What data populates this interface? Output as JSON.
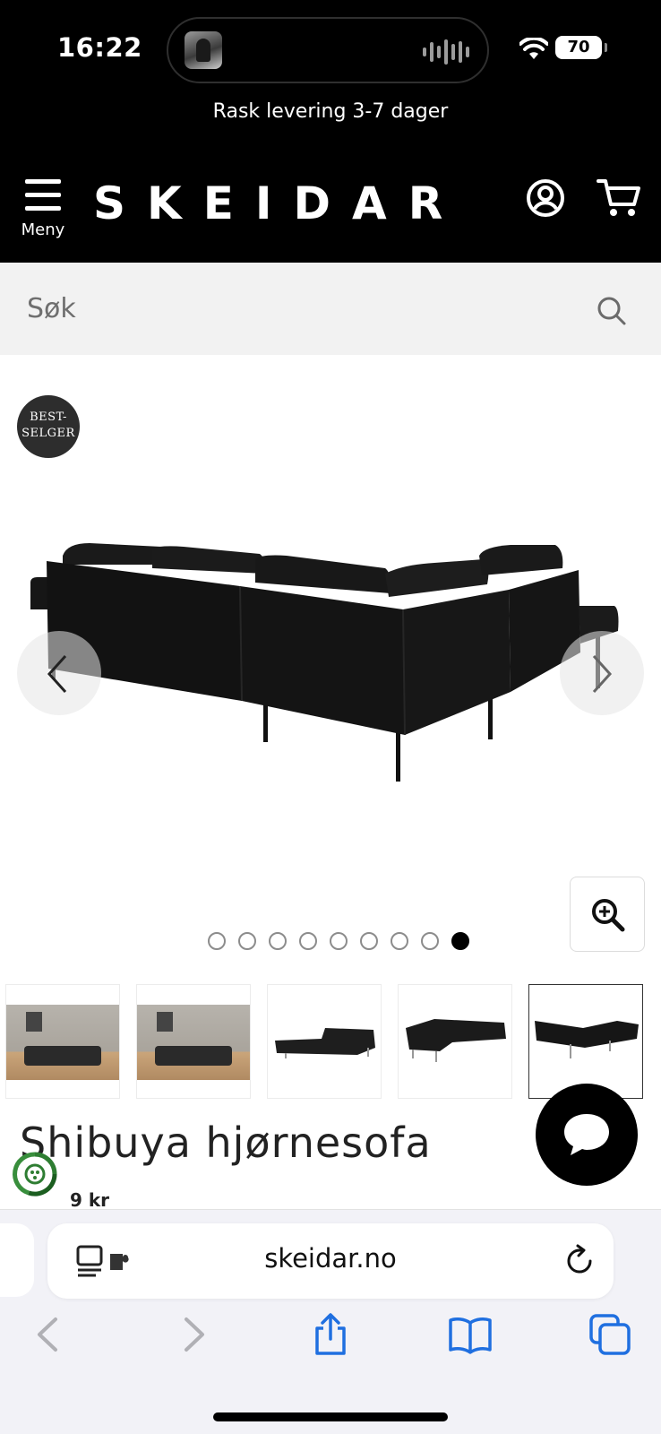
{
  "status_bar": {
    "time": "16:22",
    "battery": "70"
  },
  "header": {
    "promo_text": "Rask levering 3-7 dager",
    "menu_label": "Meny",
    "logo_text": "SKEIDAR"
  },
  "search": {
    "placeholder": "Søk"
  },
  "product": {
    "badge_line1": "BEST-",
    "badge_line2": "SELGER",
    "title": "Shibuya hjørnesofa",
    "price_partial": "9 kr",
    "image_count": 9,
    "active_image_index": 9
  },
  "thumbnails": [
    {
      "kind": "room-photo",
      "active": false
    },
    {
      "kind": "room-photo",
      "active": false
    },
    {
      "kind": "sofa-front",
      "active": false
    },
    {
      "kind": "sofa-front-alt",
      "active": false
    },
    {
      "kind": "sofa-back",
      "active": true
    }
  ],
  "browser": {
    "url": "skeidar.no"
  },
  "colors": {
    "header_bg": "#000000",
    "search_bg": "#f2f2f2",
    "browser_accent": "#1f6fe0"
  }
}
